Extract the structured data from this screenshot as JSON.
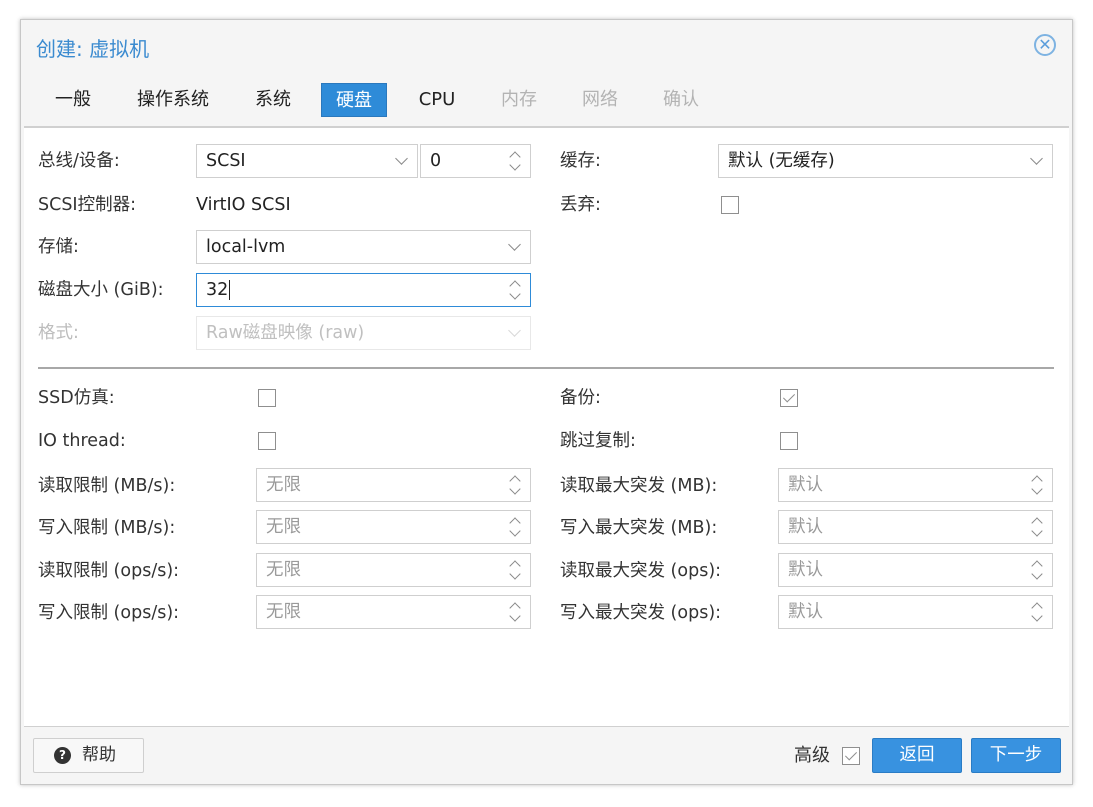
{
  "window": {
    "title": "创建: 虚拟机"
  },
  "tabs": [
    {
      "label": "一般",
      "state": "normal"
    },
    {
      "label": "操作系统",
      "state": "normal"
    },
    {
      "label": "系统",
      "state": "normal"
    },
    {
      "label": "硬盘",
      "state": "active"
    },
    {
      "label": "CPU",
      "state": "normal"
    },
    {
      "label": "内存",
      "state": "disabled"
    },
    {
      "label": "网络",
      "state": "disabled"
    },
    {
      "label": "确认",
      "state": "disabled"
    }
  ],
  "form": {
    "bus_device": {
      "label": "总线/设备:",
      "bus": "SCSI",
      "device": "0"
    },
    "scsi_controller": {
      "label": "SCSI控制器:",
      "value": "VirtIO SCSI"
    },
    "storage": {
      "label": "存储:",
      "value": "local-lvm"
    },
    "disk_size": {
      "label": "磁盘大小 (GiB):",
      "value": "32"
    },
    "format": {
      "label": "格式:",
      "value": "Raw磁盘映像 (raw)"
    },
    "cache": {
      "label": "缓存:",
      "value": "默认 (无缓存)"
    },
    "discard": {
      "label": "丢弃:",
      "checked": false
    }
  },
  "advanced": {
    "ssd": {
      "label": "SSD仿真:",
      "checked": false
    },
    "io_thread": {
      "label": "IO thread:",
      "checked": false
    },
    "backup": {
      "label": "备份:",
      "checked": true
    },
    "skip_replication": {
      "label": "跳过复制:",
      "checked": false
    },
    "read_limit_mb": {
      "label": "读取限制 (MB/s):",
      "placeholder": "无限"
    },
    "write_limit_mb": {
      "label": "写入限制 (MB/s):",
      "placeholder": "无限"
    },
    "read_limit_ops": {
      "label": "读取限制 (ops/s):",
      "placeholder": "无限"
    },
    "write_limit_ops": {
      "label": "写入限制 (ops/s):",
      "placeholder": "无限"
    },
    "read_burst_mb": {
      "label": "读取最大突发 (MB):",
      "placeholder": "默认"
    },
    "write_burst_mb": {
      "label": "写入最大突发 (MB):",
      "placeholder": "默认"
    },
    "read_burst_ops": {
      "label": "读取最大突发 (ops):",
      "placeholder": "默认"
    },
    "write_burst_ops": {
      "label": "写入最大突发 (ops):",
      "placeholder": "默认"
    }
  },
  "footer": {
    "help_label": "帮助",
    "advanced_label": "高级",
    "advanced_checked": true,
    "back_label": "返回",
    "next_label": "下一步"
  },
  "colors": {
    "accent": "#2e8bd8",
    "title": "#3b8bd0"
  }
}
